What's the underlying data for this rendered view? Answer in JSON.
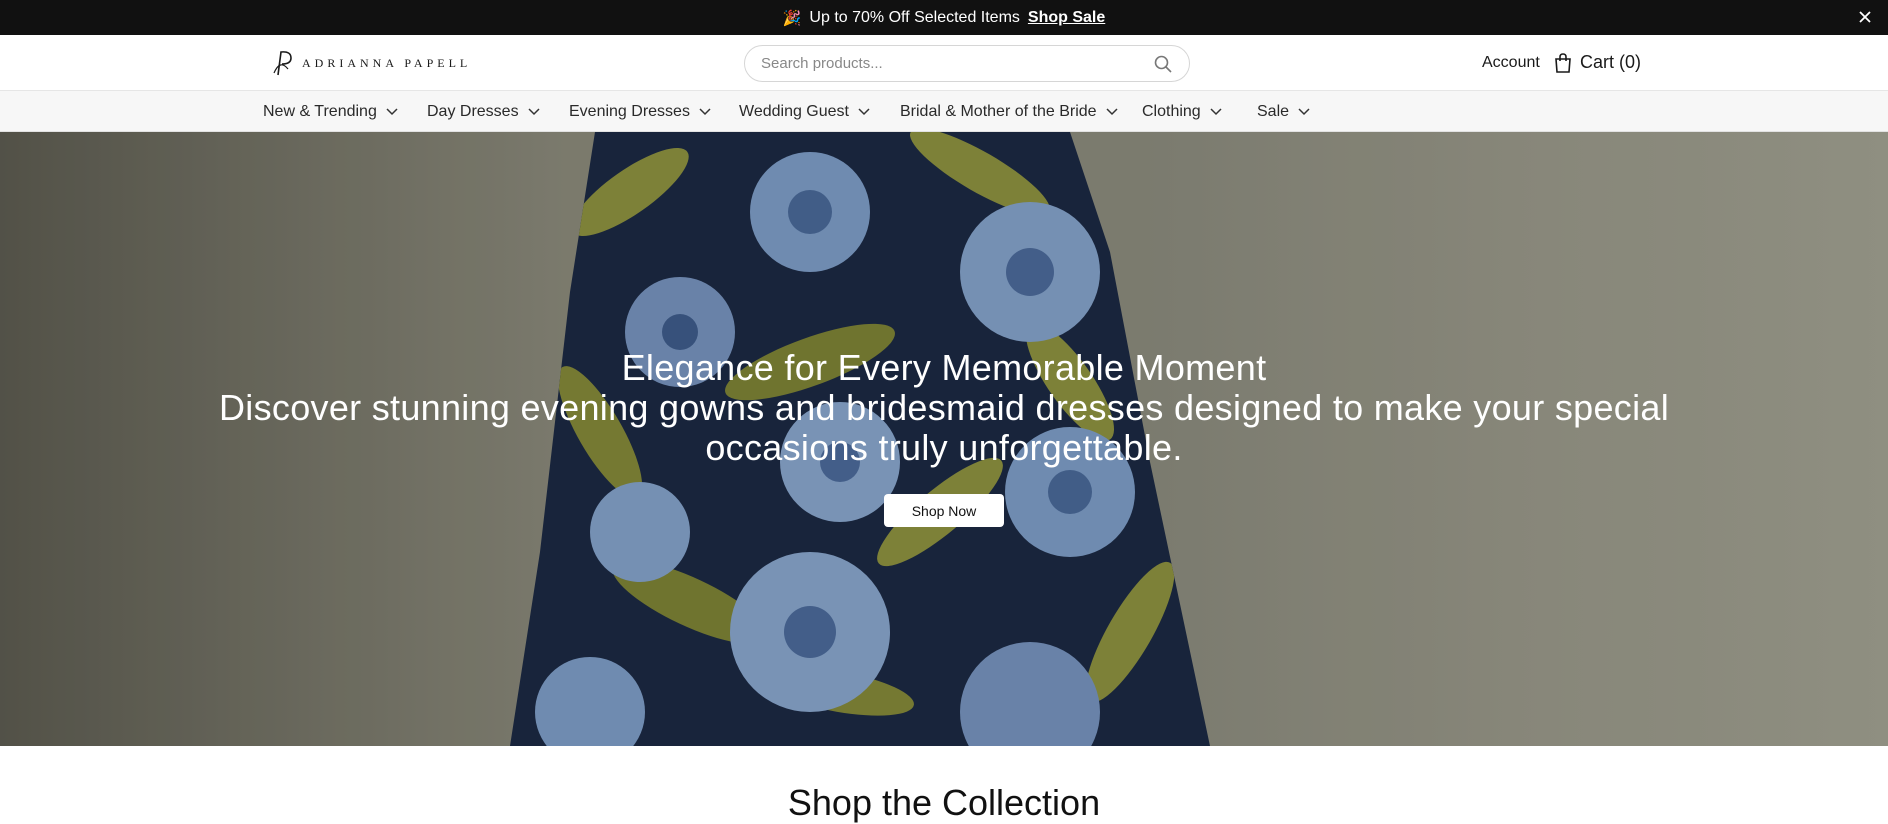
{
  "announcement": {
    "emoji": "🎉",
    "text": "Up to 70% Off Selected Items",
    "link": "Shop Sale",
    "close_icon": "close-icon"
  },
  "header": {
    "logo_text": "ADRIANNA PAPELL",
    "search_placeholder": "Search products...",
    "account_label": "Account",
    "cart_label": "Cart (0)"
  },
  "nav": {
    "items": [
      {
        "label": "New & Trending"
      },
      {
        "label": "Day Dresses"
      },
      {
        "label": "Evening Dresses"
      },
      {
        "label": "Wedding Guest"
      },
      {
        "label": "Bridal & Mother of the Bride"
      },
      {
        "label": "Clothing"
      },
      {
        "label": "Sale"
      }
    ]
  },
  "hero": {
    "title": "Elegance for Every Memorable Moment",
    "subtitle": "Discover stunning evening gowns and bridesmaid dresses designed to make your special occasions truly unforgettable.",
    "cta": "Shop Now"
  },
  "section": {
    "collection_title": "Shop the Collection"
  },
  "colors": {
    "announcement_bg": "#111111",
    "nav_bg": "#f7f7f7",
    "dress_navy": "#1c2a44",
    "flower_blue": "#7f9fc9",
    "leaf_olive": "#8f9340"
  }
}
